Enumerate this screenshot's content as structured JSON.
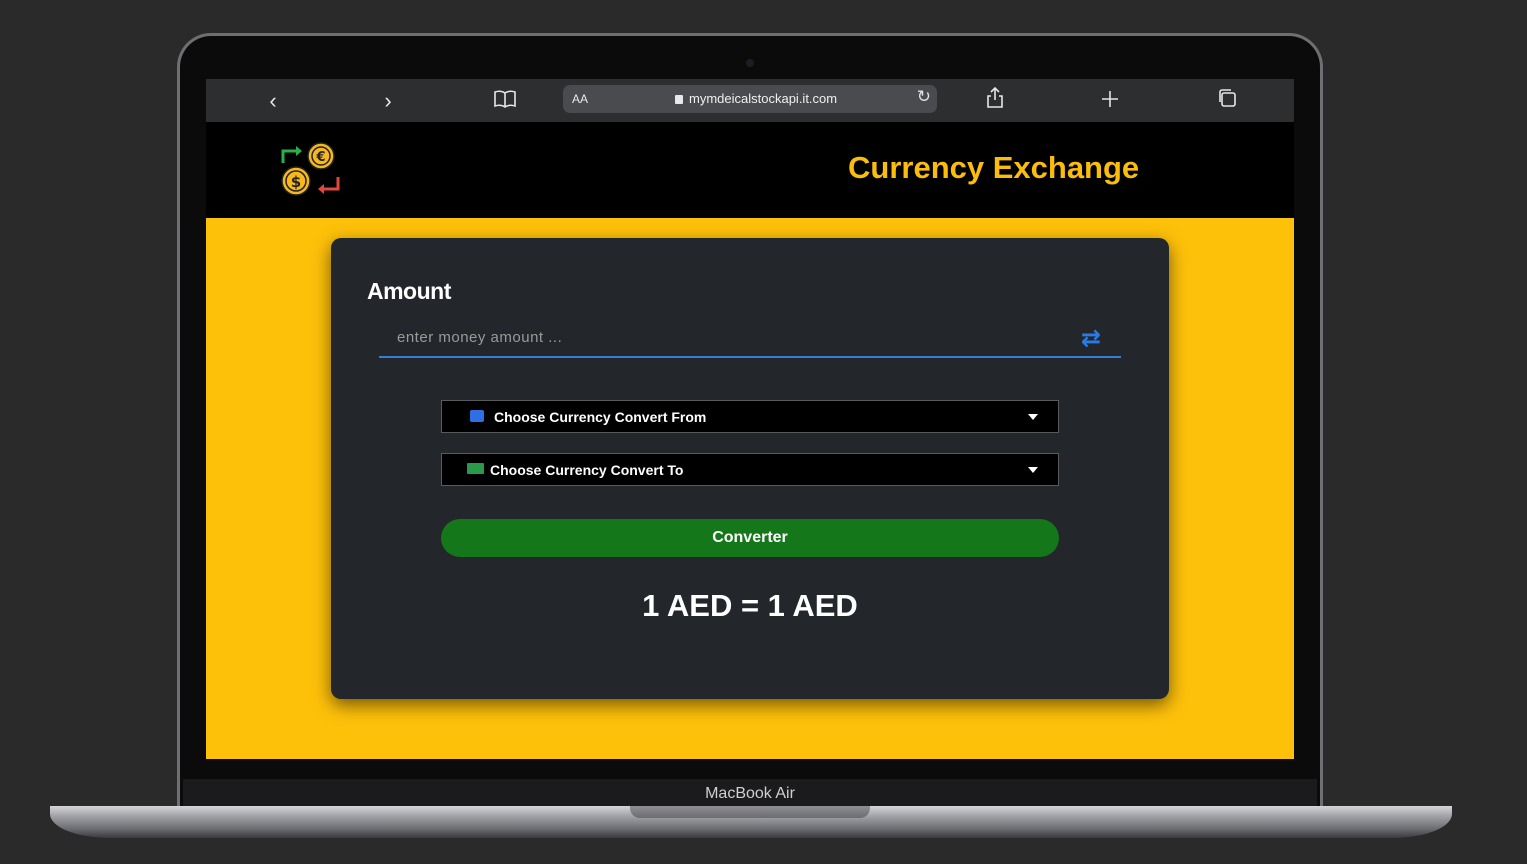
{
  "device": {
    "label": "MacBook Air"
  },
  "browser": {
    "url": "mymdeicalstockapi.it.com",
    "text_size_label": "AA"
  },
  "header": {
    "title": "Currency Exchange"
  },
  "form": {
    "amount_label": "Amount",
    "amount_placeholder": "enter money amount ...",
    "from_select": "Choose Currency Convert From",
    "to_select": "Choose Currency Convert To",
    "convert_button": "Converter",
    "result": "1 AED = 1 AED"
  },
  "colors": {
    "accent_yellow": "#fec10a",
    "title_yellow": "#fbbd0b",
    "button_green": "#14771a",
    "input_underline": "#3a7bd5"
  },
  "icons": [
    "back-icon",
    "forward-icon",
    "bookmarks-icon",
    "lock-icon",
    "reload-icon",
    "share-icon",
    "new-tab-icon",
    "tabs-icon",
    "currency-exchange-logo",
    "swap-icon",
    "credit-card-icon",
    "cash-icon",
    "caret-down-icon"
  ]
}
